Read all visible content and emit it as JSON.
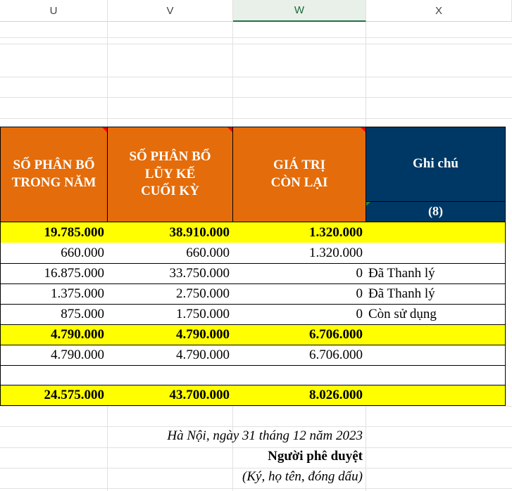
{
  "columns": [
    "U",
    "V",
    "W",
    "X"
  ],
  "headers": {
    "u": [
      "SỐ PHÂN BỔ",
      "TRONG NĂM"
    ],
    "v": [
      "SỐ PHÂN BỔ",
      "LŨY KẾ",
      "CUỐI KỲ"
    ],
    "w": [
      "GIÁ TRỊ",
      "CÒN LẠI"
    ],
    "x": "Ghi chú",
    "x_index": "(8)"
  },
  "rows": [
    {
      "u": "19.785.000",
      "v": "38.910.000",
      "w": "1.320.000",
      "x": "",
      "style": "yellow"
    },
    {
      "u": "660.000",
      "v": "660.000",
      "w": "1.320.000",
      "x": "",
      "style": "white"
    },
    {
      "u": "16.875.000",
      "v": "33.750.000",
      "w": "0",
      "x": "Đã Thanh lý",
      "style": "white"
    },
    {
      "u": "1.375.000",
      "v": "2.750.000",
      "w": "0",
      "x": "Đã Thanh lý",
      "style": "white"
    },
    {
      "u": "875.000",
      "v": "1.750.000",
      "w": "0",
      "x": "Còn sử dụng",
      "style": "white"
    },
    {
      "u": "4.790.000",
      "v": "4.790.000",
      "w": "6.706.000",
      "x": "",
      "style": "yellow"
    },
    {
      "u": "4.790.000",
      "v": "4.790.000",
      "w": "6.706.000",
      "x": "",
      "style": "white"
    },
    {
      "u": "",
      "v": "",
      "w": "",
      "x": "",
      "style": "white"
    },
    {
      "u": "24.575.000",
      "v": "43.700.000",
      "w": "8.026.000",
      "x": "",
      "style": "yellow"
    }
  ],
  "footer": {
    "place_date": "Hà Nội, ngày 31 tháng 12 năm 2023",
    "approver": "Người phê duyệt",
    "sign_note": "(Ký, họ tên, đóng dấu)"
  },
  "colors": {
    "header_orange": "#e46c0a",
    "header_navy": "#003865",
    "highlight_yellow": "#ffff00",
    "selected_column": "#1e7145"
  }
}
